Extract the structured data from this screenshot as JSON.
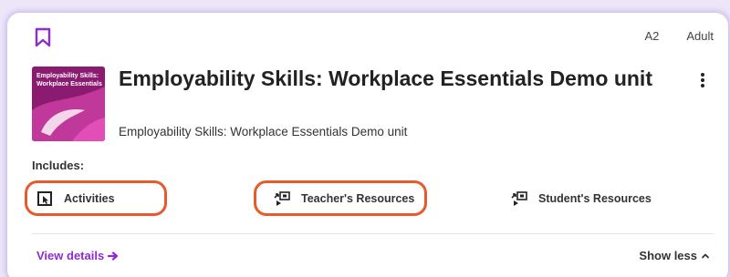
{
  "card": {
    "levels": [
      "A2",
      "Adult"
    ],
    "thumbnail_text": "Employability Skills: Workplace Essentials",
    "title": "Employability Skills: Workplace Essentials Demo unit",
    "subtitle": "Employability Skills: Workplace Essentials Demo unit",
    "includes_label": "Includes:",
    "resources": [
      {
        "label": "Activities",
        "icon": "activity-icon",
        "highlighted": true
      },
      {
        "label": "Teacher's Resources",
        "icon": "resources-icon",
        "highlighted": true
      },
      {
        "label": "Student's Resources",
        "icon": "resources-icon",
        "highlighted": false
      }
    ],
    "view_details_label": "View details",
    "show_less_label": "Show less"
  },
  "colors": {
    "accent": "#8e2bd4",
    "highlight": "#e85a2c",
    "thumbnail": "#8a1b70"
  }
}
